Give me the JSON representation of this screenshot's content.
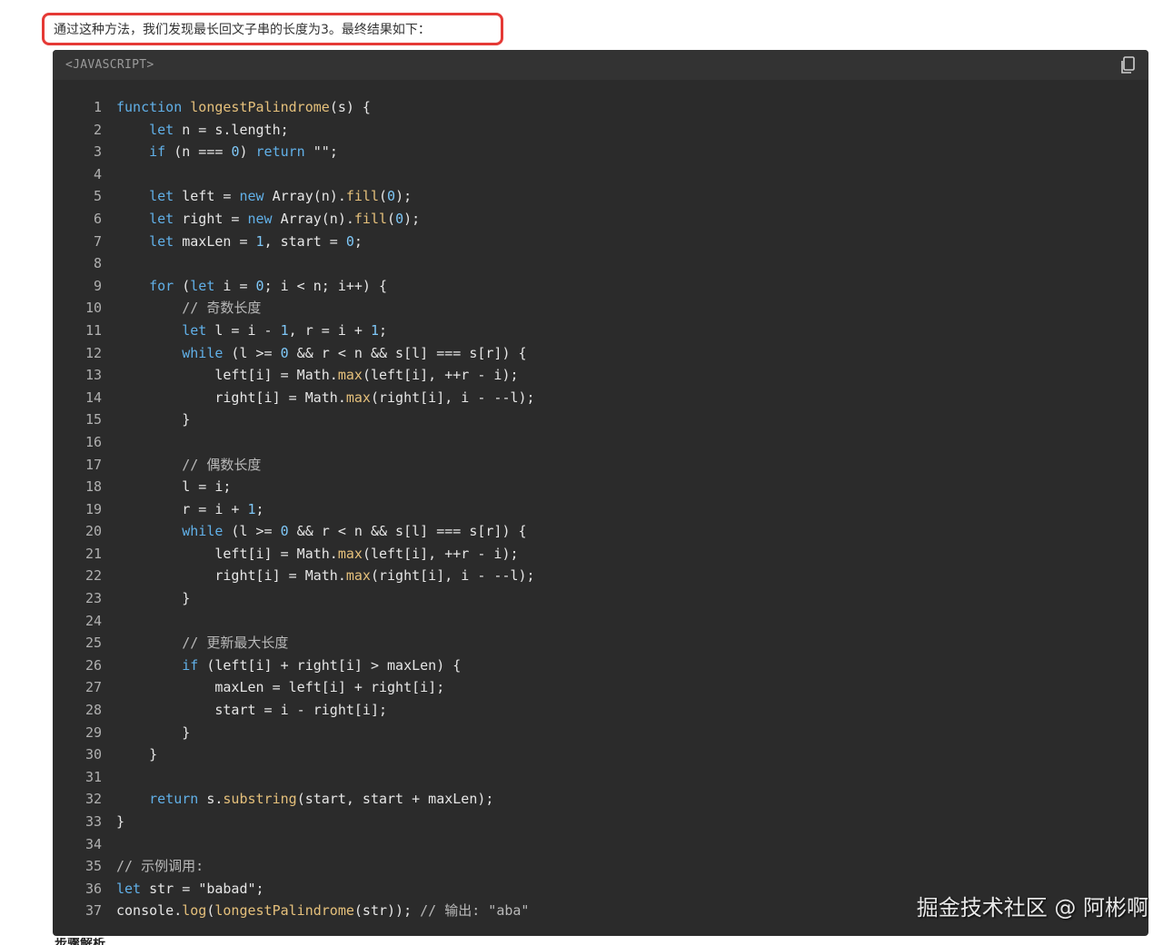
{
  "intro": {
    "text": "通过这种方法，我们发现最长回文子串的长度为3。最终结果如下："
  },
  "code": {
    "language": "<JAVASCRIPT>",
    "copy_icon": "copy-icon",
    "lines": [
      "function longestPalindrome(s) {",
      "    let n = s.length;",
      "    if (n === 0) return \"\";",
      "",
      "    let left = new Array(n).fill(0);",
      "    let right = new Array(n).fill(0);",
      "    let maxLen = 1, start = 0;",
      "",
      "    for (let i = 0; i < n; i++) {",
      "        // 奇数长度",
      "        let l = i - 1, r = i + 1;",
      "        while (l >= 0 && r < n && s[l] === s[r]) {",
      "            left[i] = Math.max(left[i], ++r - i);",
      "            right[i] = Math.max(right[i], i - --l);",
      "        }",
      "",
      "        // 偶数长度",
      "        l = i;",
      "        r = i + 1;",
      "        while (l >= 0 && r < n && s[l] === s[r]) {",
      "            left[i] = Math.max(left[i], ++r - i);",
      "            right[i] = Math.max(right[i], i - --l);",
      "        }",
      "",
      "        // 更新最大长度",
      "        if (left[i] + right[i] > maxLen) {",
      "            maxLen = left[i] + right[i];",
      "            start = i - right[i];",
      "        }",
      "    }",
      "",
      "    return s.substring(start, start + maxLen);",
      "}",
      "",
      "// 示例调用:",
      "let str = \"babad\";",
      "console.log(longestPalindrome(str)); // 输出: \"aba\""
    ]
  },
  "watermark": {
    "text": "掘金技术社区 @ 阿彬啊"
  },
  "next_heading": {
    "text": "步骤解析"
  }
}
